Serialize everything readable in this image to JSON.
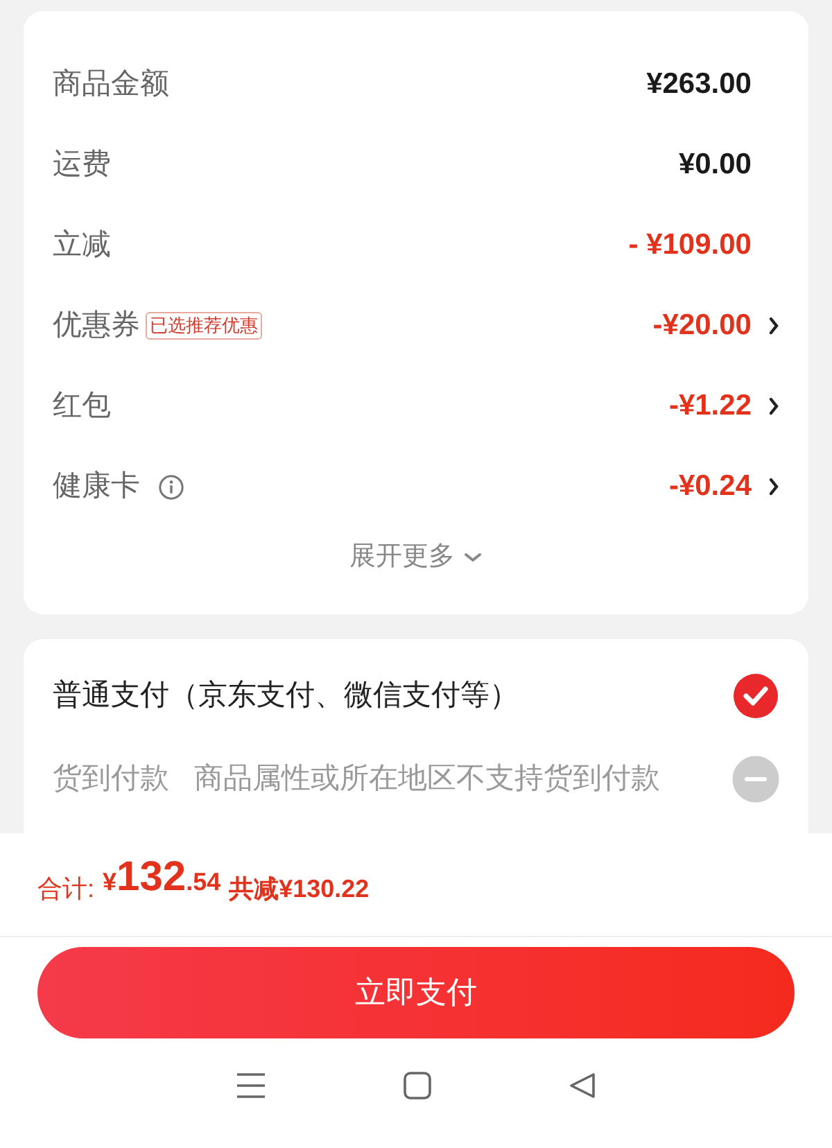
{
  "fees": [
    {
      "label": "商品金额",
      "amount": "¥263.00",
      "kind": "normal",
      "arrow": false
    },
    {
      "label": "运费",
      "amount": "¥0.00",
      "kind": "normal",
      "arrow": false
    },
    {
      "label": "立减",
      "amount": "- ¥109.00",
      "kind": "discount",
      "arrow": false
    },
    {
      "label": "优惠券",
      "badge": "已选推荐优惠",
      "amount": "-¥20.00",
      "kind": "discount",
      "arrow": true
    },
    {
      "label": "红包",
      "amount": "-¥1.22",
      "kind": "discount",
      "arrow": true
    },
    {
      "label": "健康卡",
      "info": true,
      "amount": "-¥0.24",
      "kind": "discount",
      "arrow": true
    }
  ],
  "expand": "展开更多",
  "payment_options": [
    {
      "label": "普通支付（京东支付、微信支付等）",
      "selected": true,
      "disabled": false
    },
    {
      "label": "货到付款",
      "note": "商品属性或所在地区不支持货到付款",
      "selected": false,
      "disabled": true
    }
  ],
  "total": {
    "label": "合计:",
    "currency": "¥",
    "integer": "132",
    "decimal": ".54",
    "saved": "共减¥130.22"
  },
  "pay_button": "立即支付"
}
